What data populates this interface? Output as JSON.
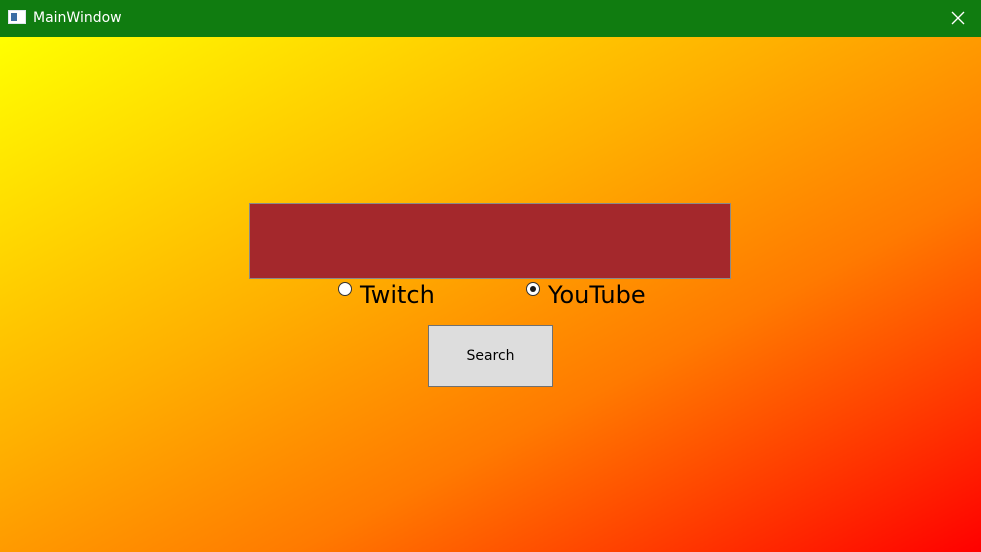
{
  "window": {
    "title": "MainWindow",
    "titlebar_color": "#107c10",
    "app_icon": "window-icon",
    "close_icon": "close-icon"
  },
  "content": {
    "background_gradient": [
      "#ffff00",
      "#ffb000",
      "#ff7a00",
      "#ff0000"
    ],
    "search": {
      "value": "",
      "placeholder": "",
      "background_color": "#a4282c"
    },
    "platforms": {
      "options": [
        {
          "label": "Twitch",
          "checked": false
        },
        {
          "label": "YouTube",
          "checked": true
        }
      ]
    },
    "search_button": {
      "label": "Search"
    }
  }
}
